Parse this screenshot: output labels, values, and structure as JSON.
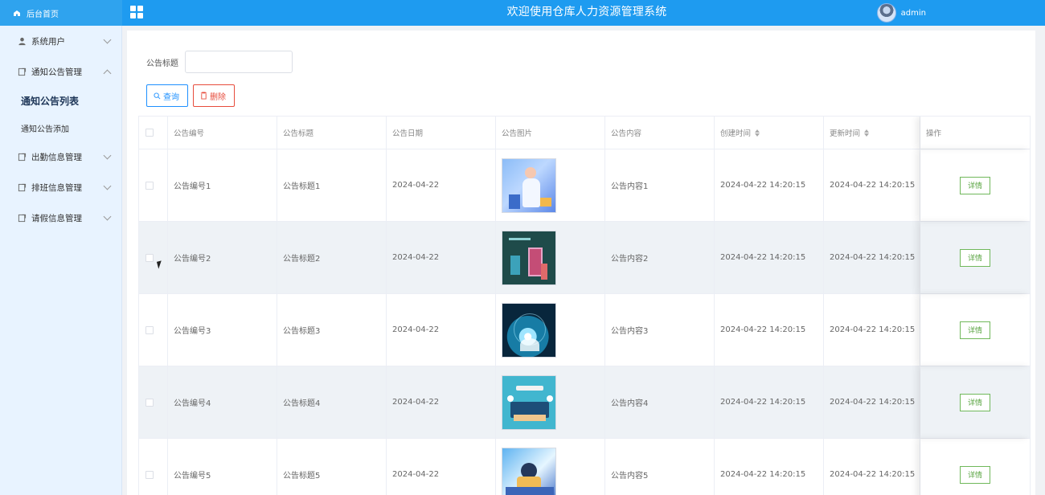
{
  "brand": {
    "label": "后台首页"
  },
  "header": {
    "title": "欢迎使用仓库人力资源管理系统",
    "user": "admin"
  },
  "sidebar": {
    "items": [
      {
        "label": "系统用户",
        "icon": "user-icon",
        "expanded": false
      },
      {
        "label": "通知公告管理",
        "icon": "notice-icon",
        "expanded": true
      },
      {
        "label": "通知公告列表",
        "active": true
      },
      {
        "label": "通知公告添加",
        "active": false
      },
      {
        "label": "出勤信息管理",
        "icon": "attendance-icon",
        "expanded": false
      },
      {
        "label": "排班信息管理",
        "icon": "schedule-icon",
        "expanded": false
      },
      {
        "label": "请假信息管理",
        "icon": "leave-icon",
        "expanded": false
      }
    ]
  },
  "filters": {
    "title_label": "公告标题",
    "title_value": "",
    "query_label": "查询",
    "delete_label": "删除"
  },
  "table": {
    "columns": [
      "公告编号",
      "公告标题",
      "公告日期",
      "公告图片",
      "公告内容",
      "创建时间",
      "更新时间",
      "操作"
    ],
    "rows": [
      {
        "no": "公告编号1",
        "title": "公告标题1",
        "date": "2024-04-22",
        "content": "公告内容1",
        "created": "2024-04-22 14:20:15",
        "updated": "2024-04-22 14:20:15",
        "action": "详情"
      },
      {
        "no": "公告编号2",
        "title": "公告标题2",
        "date": "2024-04-22",
        "content": "公告内容2",
        "created": "2024-04-22 14:20:15",
        "updated": "2024-04-22 14:20:15",
        "action": "详情"
      },
      {
        "no": "公告编号3",
        "title": "公告标题3",
        "date": "2024-04-22",
        "content": "公告内容3",
        "created": "2024-04-22 14:20:15",
        "updated": "2024-04-22 14:20:15",
        "action": "详情"
      },
      {
        "no": "公告编号4",
        "title": "公告标题4",
        "date": "2024-04-22",
        "content": "公告内容4",
        "created": "2024-04-22 14:20:15",
        "updated": "2024-04-22 14:20:15",
        "action": "详情"
      },
      {
        "no": "公告编号5",
        "title": "公告标题5",
        "date": "2024-04-22",
        "content": "公告内容5",
        "created": "2024-04-22 14:20:15",
        "updated": "2024-04-22 14:20:15",
        "action": "详情"
      }
    ]
  },
  "colors": {
    "header": "#1e9bf0",
    "sidebar": "#e8f3ff",
    "primary": "#1e90ff",
    "danger": "#e74c3c",
    "success": "#59a441"
  }
}
